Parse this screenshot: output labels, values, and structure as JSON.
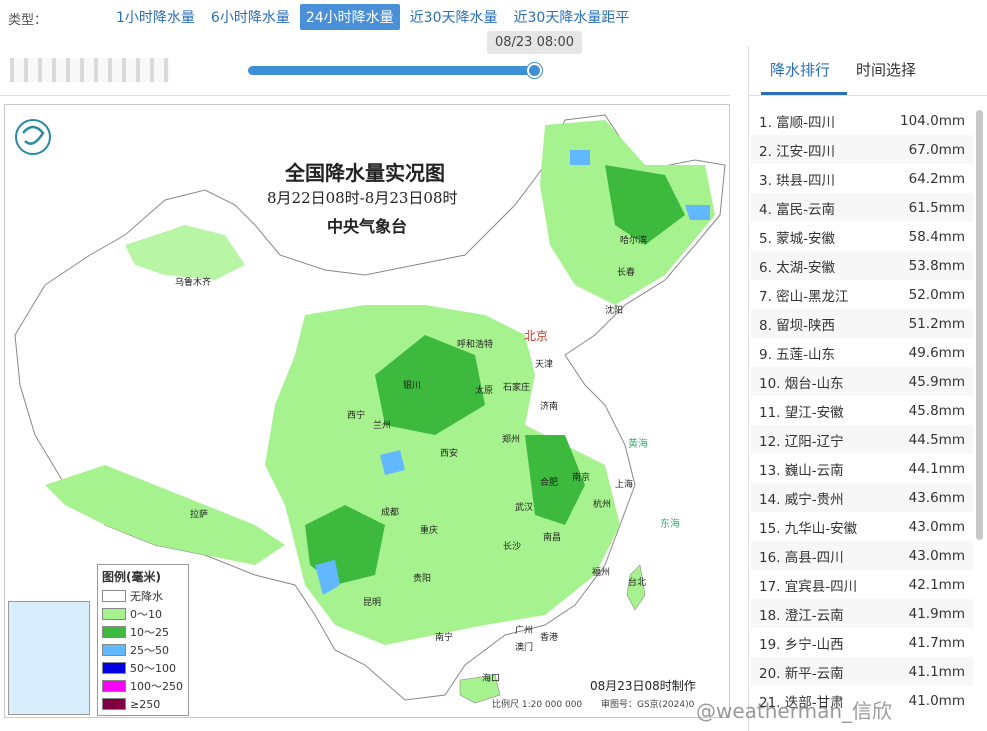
{
  "toolbar": {
    "type_label": "类型：",
    "tabs": [
      "1小时降水量",
      "6小时降水量",
      "24小时降水量",
      "近30天降水量",
      "近30天降水量距平"
    ],
    "active_tab": "24小时降水量"
  },
  "timeline": {
    "current_time": "08/23 08:00",
    "progress": 1.0
  },
  "map": {
    "title": "全国降水量实况图",
    "subtitle": "8月22日08时-8月23日08时",
    "org": "中央气象台",
    "made_note": "08月23日08时制作",
    "scale": "比例尺 1:20 000 000",
    "approval": "审图号：GS京(2024)0",
    "capital": "北京",
    "cities": [
      "乌鲁木齐",
      "哈尔滨",
      "长春",
      "沈阳",
      "呼和浩特",
      "天津",
      "太原",
      "石家庄",
      "银川",
      "济南",
      "西宁",
      "兰州",
      "西安",
      "郑州",
      "拉萨",
      "成都",
      "合肥",
      "南京",
      "上海",
      "武汉",
      "杭州",
      "重庆",
      "南昌",
      "长沙",
      "贵阳",
      "福州",
      "昆明",
      "台北",
      "南宁",
      "广州",
      "香港",
      "澳门",
      "海口"
    ],
    "sea_labels": [
      "黄海",
      "东海"
    ],
    "legend": {
      "title": "图例(毫米)",
      "items": [
        {
          "label": "无降水",
          "color": "#ffffff"
        },
        {
          "label": "0～10",
          "color": "#a6f28f"
        },
        {
          "label": "10～25",
          "color": "#3dba3d"
        },
        {
          "label": "25～50",
          "color": "#61b8ff"
        },
        {
          "label": "50～100",
          "color": "#0000e1"
        },
        {
          "label": "100～250",
          "color": "#fa00fa"
        },
        {
          "label": "≥250",
          "color": "#800040"
        }
      ]
    }
  },
  "sidebar": {
    "tabs": [
      "降水排行",
      "时间选择"
    ],
    "active_tab": "降水排行",
    "ranking": [
      {
        "name": "1. 富顺-四川",
        "value": "104.0mm"
      },
      {
        "name": "2. 江安-四川",
        "value": "67.0mm"
      },
      {
        "name": "3. 珙县-四川",
        "value": "64.2mm"
      },
      {
        "name": "4. 富民-云南",
        "value": "61.5mm"
      },
      {
        "name": "5. 蒙城-安徽",
        "value": "58.4mm"
      },
      {
        "name": "6. 太湖-安徽",
        "value": "53.8mm"
      },
      {
        "name": "7. 密山-黑龙江",
        "value": "52.0mm"
      },
      {
        "name": "8. 留坝-陕西",
        "value": "51.2mm"
      },
      {
        "name": "9. 五莲-山东",
        "value": "49.6mm"
      },
      {
        "name": "10. 烟台-山东",
        "value": "45.9mm"
      },
      {
        "name": "11. 望江-安徽",
        "value": "45.8mm"
      },
      {
        "name": "12. 辽阳-辽宁",
        "value": "44.5mm"
      },
      {
        "name": "13. 巍山-云南",
        "value": "44.1mm"
      },
      {
        "name": "14. 威宁-贵州",
        "value": "43.6mm"
      },
      {
        "name": "15. 九华山-安徽",
        "value": "43.0mm"
      },
      {
        "name": "16. 高县-四川",
        "value": "43.0mm"
      },
      {
        "name": "17. 宜宾县-四川",
        "value": "42.1mm"
      },
      {
        "name": "18. 澄江-云南",
        "value": "41.9mm"
      },
      {
        "name": "19. 乡宁-山西",
        "value": "41.7mm"
      },
      {
        "name": "20. 新平-云南",
        "value": "41.1mm"
      },
      {
        "name": "21. 迭部-甘肃",
        "value": "41.0mm"
      }
    ]
  },
  "watermark": "@weatherman_信欣"
}
